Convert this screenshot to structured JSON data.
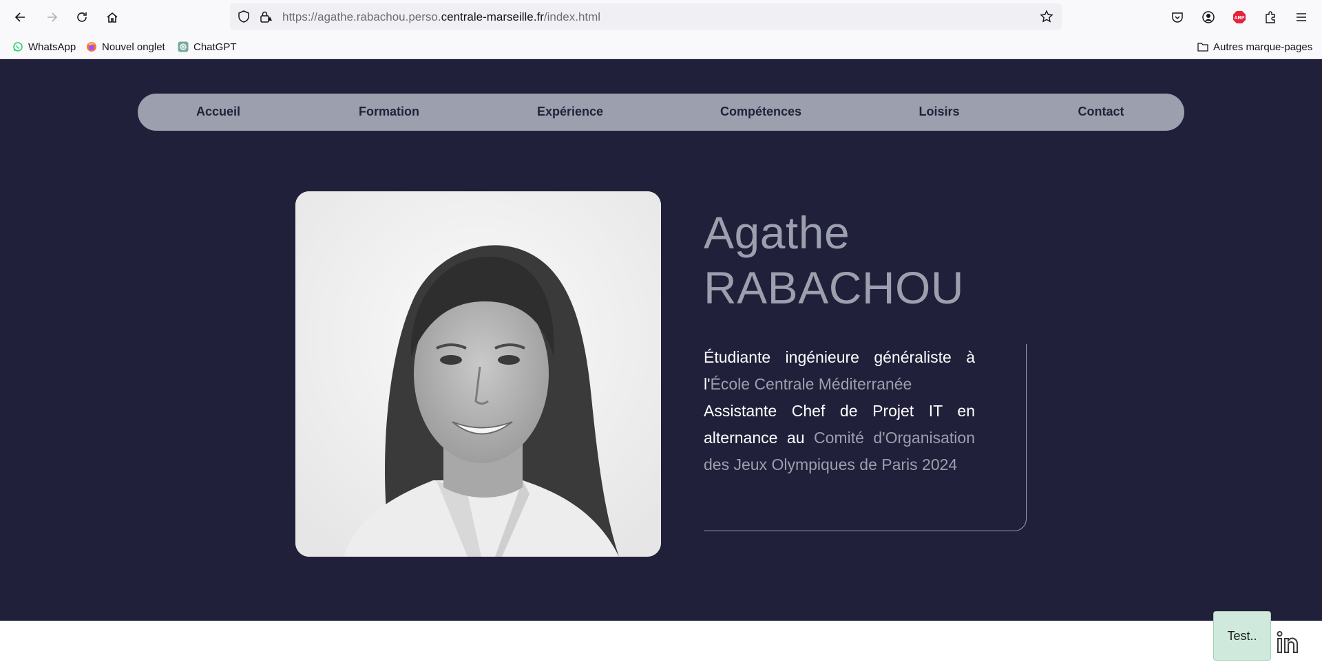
{
  "browser": {
    "url_prefix": "https://agathe.rabachou.perso.",
    "url_domain": "centrale-marseille.fr",
    "url_path": "/index.html",
    "bookmarks": [
      {
        "label": "WhatsApp",
        "icon": "whatsapp-icon"
      },
      {
        "label": "Nouvel onglet",
        "icon": "firefox-icon"
      },
      {
        "label": "ChatGPT",
        "icon": "chatgpt-icon"
      }
    ],
    "other_bookmarks": "Autres marque-pages",
    "adblock_badge": "ABP"
  },
  "nav": {
    "items": [
      "Accueil",
      "Formation",
      "Expérience",
      "Compétences",
      "Loisirs",
      "Contact"
    ]
  },
  "profile": {
    "first_name": "Agathe",
    "last_name": "RABACHOU",
    "bio": {
      "line1": "Étudiante ingénieure généraliste à l'",
      "school": "École Centrale Méditerranée",
      "line2": "Assistante Chef de Projet IT en alternance au ",
      "org": "Comité d'Organisation des Jeux Olympiques de Paris 2024"
    }
  },
  "widgets": {
    "test_label": "Test..",
    "linkedin_icon": "linkedin-icon"
  },
  "colors": {
    "hero_bg": "#20203a",
    "nav_bg": "#9c9fae",
    "accent_text": "#9c9fae"
  }
}
